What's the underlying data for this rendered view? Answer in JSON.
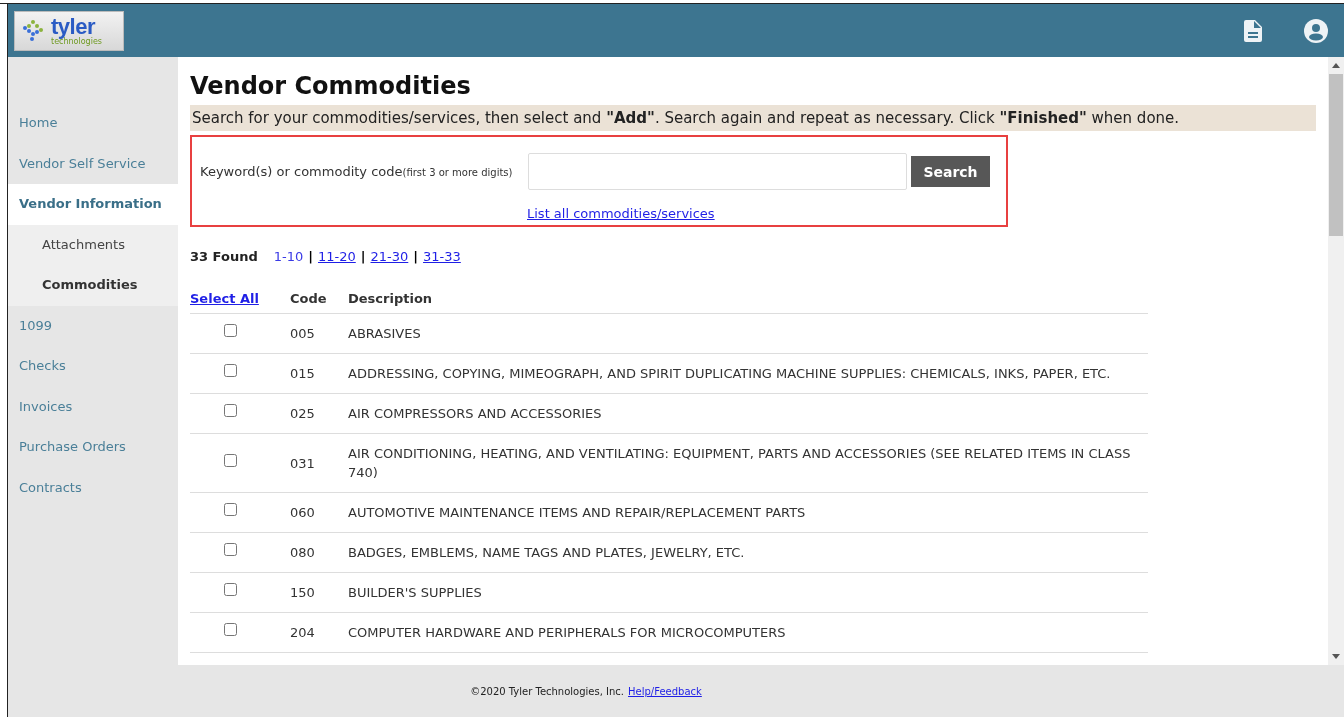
{
  "header": {
    "logo": {
      "name": "tyler",
      "tagline": "technologies"
    }
  },
  "sidebar": {
    "items": [
      {
        "label": "Home",
        "selected": false
      },
      {
        "label": "Vendor Self Service",
        "selected": false
      },
      {
        "label": "Vendor Information",
        "selected": true,
        "children": [
          {
            "label": "Attachments",
            "selected": false
          },
          {
            "label": "Commodities",
            "selected": true
          }
        ]
      },
      {
        "label": "1099",
        "selected": false
      },
      {
        "label": "Checks",
        "selected": false
      },
      {
        "label": "Invoices",
        "selected": false
      },
      {
        "label": "Purchase Orders",
        "selected": false
      },
      {
        "label": "Contracts",
        "selected": false
      }
    ]
  },
  "title": "Vendor Commodities",
  "instructions": "Search for your commodities/services, then select and **\"Add\"**. Search again and repeat as necessary. Click **\"Finished\"** when done.",
  "search_box": {
    "label": "Keyword(s) or commodity code",
    "hint": "(first 3 or more digits)",
    "button": "Search",
    "list_all_link": "List all commodities/services"
  },
  "results": {
    "count": "33 Found",
    "separator": "|",
    "pages": [
      {
        "label": "1-10",
        "selected": true
      },
      {
        "label": "11-20",
        "selected": false
      },
      {
        "label": "21-30",
        "selected": false
      },
      {
        "label": "31-33",
        "selected": false
      }
    ]
  },
  "table": {
    "select_all": "Select All",
    "columns": [
      "Code",
      "Description"
    ],
    "rows": [
      {
        "checked": false,
        "code": "005",
        "description": "ABRASIVES"
      },
      {
        "checked": false,
        "code": "015",
        "description": "ADDRESSING, COPYING, MIMEOGRAPH, AND SPIRIT DUPLICATING MACHINE SUPPLIES: CHEMICALS, INKS, PAPER, ETC."
      },
      {
        "checked": false,
        "code": "025",
        "description": "AIR COMPRESSORS AND ACCESSORIES"
      },
      {
        "checked": false,
        "code": "031",
        "description": "AIR CONDITIONING, HEATING, AND VENTILATING: EQUIPMENT, PARTS AND ACCESSORIES (SEE RELATED ITEMS IN CLASS 740)"
      },
      {
        "checked": false,
        "code": "060",
        "description": "AUTOMOTIVE MAINTENANCE ITEMS AND REPAIR/REPLACEMENT PARTS"
      },
      {
        "checked": false,
        "code": "080",
        "description": "BADGES, EMBLEMS, NAME TAGS AND PLATES, JEWELRY, ETC."
      },
      {
        "checked": false,
        "code": "150",
        "description": "BUILDER'S SUPPLIES"
      },
      {
        "checked": false,
        "code": "204",
        "description": "COMPUTER HARDWARE AND PERIPHERALS FOR MICROCOMPUTERS"
      }
    ]
  },
  "footer": {
    "copyright": "©2020 Tyler Technologies, Inc.",
    "link": "Help/Feedback"
  }
}
